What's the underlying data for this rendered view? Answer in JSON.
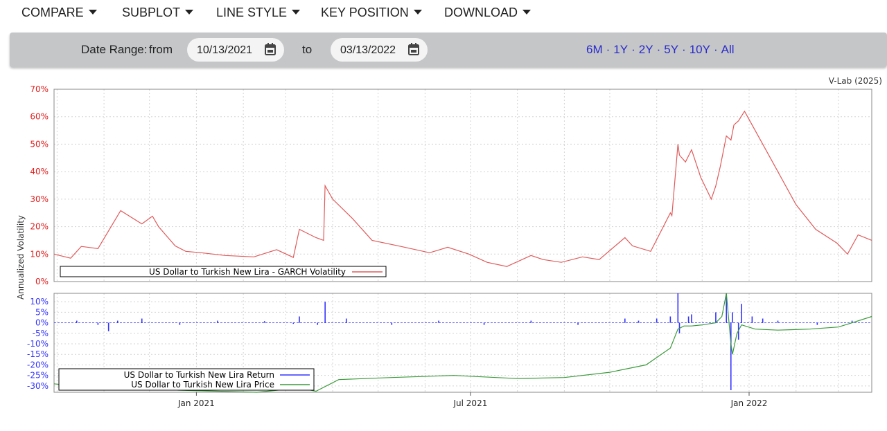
{
  "menu": [
    {
      "label": "COMPARE",
      "name": "compare-menu"
    },
    {
      "label": "SUBPLOT",
      "name": "subplot-menu"
    },
    {
      "label": "LINE STYLE",
      "name": "line-style-menu"
    },
    {
      "label": "KEY POSITION",
      "name": "key-position-menu"
    },
    {
      "label": "DOWNLOAD",
      "name": "download-menu"
    }
  ],
  "date_range": {
    "label": "Date Range:",
    "from_label": "from",
    "from_value": "10/13/2021",
    "to_label": "to",
    "to_value": "03/13/2022"
  },
  "presets": [
    "6M",
    "1Y",
    "2Y",
    "5Y",
    "10Y",
    "All"
  ],
  "colors": {
    "volatility": "#e05a5a",
    "returns": "#3333ff",
    "price": "#3a9a3a",
    "accent": "#2a2acb",
    "top_axis_text": "#e02020"
  },
  "chart_data": [
    {
      "type": "line",
      "ylabel": "Annualized Volatility",
      "ylim": [
        0,
        70
      ],
      "yticks": [
        "0%",
        "10%",
        "20%",
        "30%",
        "40%",
        "50%",
        "60%",
        "70%"
      ],
      "credit": "V-Lab (2025)",
      "grid": true,
      "legend_placement": "bottom-left",
      "series": [
        {
          "name": "US Dollar to Turkish New Lira - GARCH Volatility",
          "color": "#e05a5a",
          "x": [
            "2020-09-29",
            "2020-10-10",
            "2020-10-17",
            "2020-10-28",
            "2020-11-12",
            "2020-11-26",
            "2020-12-03",
            "2020-12-07",
            "2020-12-18",
            "2020-12-25",
            "2021-01-04",
            "2021-01-20",
            "2021-02-08",
            "2021-02-23",
            "2021-03-06",
            "2021-03-10",
            "2021-03-21",
            "2021-03-26",
            "2021-03-27",
            "2021-04-01",
            "2021-04-14",
            "2021-04-27",
            "2021-05-16",
            "2021-06-04",
            "2021-06-16",
            "2021-06-30",
            "2021-07-12",
            "2021-07-25",
            "2021-08-10",
            "2021-08-18",
            "2021-08-30",
            "2021-09-13",
            "2021-09-24",
            "2021-10-11",
            "2021-10-16",
            "2021-10-28",
            "2021-11-10",
            "2021-11-11",
            "2021-11-15",
            "2021-11-16",
            "2021-11-20",
            "2021-11-24",
            "2021-11-30",
            "2021-12-07",
            "2021-12-10",
            "2021-12-13",
            "2021-12-17",
            "2021-12-20",
            "2021-12-22",
            "2021-12-25",
            "2021-12-29",
            "2022-01-02",
            "2022-01-10",
            "2022-01-20",
            "2022-02-01",
            "2022-02-14",
            "2022-02-28",
            "2022-03-07",
            "2022-03-14",
            "2022-03-23"
          ],
          "y": [
            10,
            8.5,
            12.8,
            12,
            25.8,
            21,
            23.8,
            20,
            13,
            11,
            10.5,
            9.5,
            9,
            11.6,
            8.8,
            19,
            16,
            15,
            34.9,
            30,
            23,
            15,
            12.8,
            10.5,
            12.5,
            10,
            7,
            5.5,
            9.5,
            8,
            7,
            9,
            8,
            16,
            13,
            11,
            25,
            24,
            50,
            46,
            43.5,
            48,
            38,
            30,
            34.8,
            42,
            53,
            51.5,
            57,
            58.5,
            62,
            58,
            50,
            40,
            28,
            19,
            14,
            10,
            17,
            15
          ]
        }
      ]
    },
    {
      "type": "line",
      "ylim": [
        -33,
        14
      ],
      "yticks": [
        "10%",
        "5%",
        "0%",
        "-5%",
        "-10%",
        "-15%",
        "-20%",
        "-25%",
        "-30%"
      ],
      "xticks": [
        "Jan 2021",
        "Jul 2021",
        "Jan 2022"
      ],
      "grid": true,
      "legend_placement": "bottom-left",
      "series": [
        {
          "name": "US Dollar to Turkish New Lira Return",
          "color": "#3333ff",
          "x": [
            "2020-10-14",
            "2020-10-28",
            "2020-11-04",
            "2020-11-10",
            "2020-11-26",
            "2020-12-21",
            "2021-01-15",
            "2021-02-15",
            "2021-03-06",
            "2021-03-10",
            "2021-03-22",
            "2021-03-27",
            "2021-04-10",
            "2021-05-10",
            "2021-06-10",
            "2021-07-10",
            "2021-08-10",
            "2021-09-10",
            "2021-10-11",
            "2021-10-20",
            "2021-11-01",
            "2021-11-10",
            "2021-11-15",
            "2021-11-16",
            "2021-11-22",
            "2021-11-24",
            "2021-12-10",
            "2021-12-17",
            "2021-12-20",
            "2021-12-21",
            "2021-12-25",
            "2021-12-27",
            "2022-01-03",
            "2022-01-10",
            "2022-01-20",
            "2022-02-15",
            "2022-03-10"
          ],
          "y": [
            1,
            -1,
            -4,
            1,
            2,
            -1,
            1,
            0.8,
            -0.5,
            3,
            -1,
            10,
            2,
            -1,
            1,
            -1,
            1,
            -1,
            2,
            1,
            2,
            3,
            14,
            -5,
            3,
            4,
            5,
            14,
            -32,
            5,
            -8,
            9,
            3,
            2,
            1,
            -1,
            1
          ]
        },
        {
          "name": "US Dollar to Turkish New Lira Price",
          "color": "#3a9a3a",
          "x": [
            "2020-09-29",
            "2020-10-25",
            "2020-11-18",
            "2020-12-20",
            "2021-01-15",
            "2021-02-10",
            "2021-03-10",
            "2021-03-21",
            "2021-04-05",
            "2021-05-10",
            "2021-06-20",
            "2021-08-01",
            "2021-09-01",
            "2021-10-01",
            "2021-10-25",
            "2021-11-10",
            "2021-11-15",
            "2021-11-19",
            "2021-11-24",
            "2021-12-01",
            "2021-12-10",
            "2021-12-14",
            "2021-12-17",
            "2021-12-20",
            "2021-12-21",
            "2021-12-24",
            "2021-12-27",
            "2022-01-05",
            "2022-01-20",
            "2022-02-10",
            "2022-03-01",
            "2022-03-10",
            "2022-03-23"
          ],
          "y": [
            -29,
            -31,
            -30,
            -32,
            -32.5,
            -33,
            -31,
            -32.5,
            -27,
            -26,
            -25,
            -26.5,
            -26,
            -23.5,
            -20,
            -12,
            -3,
            -1.5,
            -1.5,
            -1,
            0,
            3,
            14,
            -10,
            -15,
            -5,
            -1,
            -3,
            -3.5,
            -3,
            -2,
            0,
            3
          ]
        }
      ]
    }
  ]
}
